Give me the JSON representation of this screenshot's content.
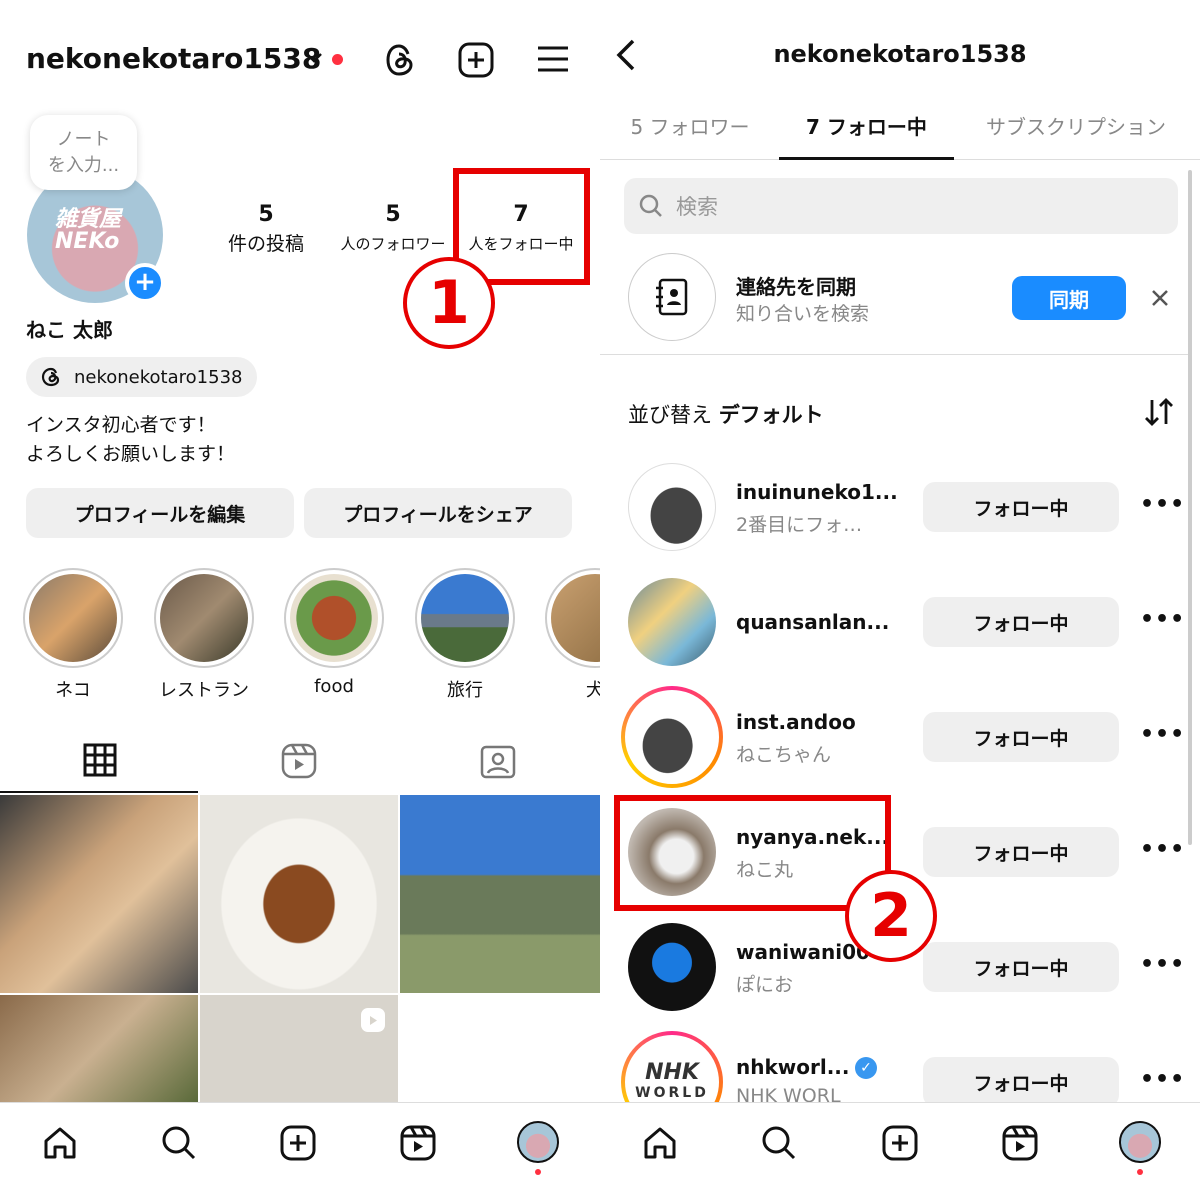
{
  "left": {
    "username": "nekonekotaro1538",
    "note": [
      "ノート",
      "を入力..."
    ],
    "avatar_text": [
      "雑貨屋",
      "NEKo"
    ],
    "stats": [
      {
        "value": "5",
        "label": "件の投稿"
      },
      {
        "value": "5",
        "label": "人のフォロワー"
      },
      {
        "value": "7",
        "label": "人をフォロー中"
      }
    ],
    "display_name": "ねこ 太郎",
    "threads_handle": "nekonekotaro1538",
    "bio": [
      "インスタ初心者です！",
      "よろしくお願いします！"
    ],
    "edit_profile": "プロフィールを編集",
    "share_profile": "プロフィールをシェア",
    "highlights": [
      "ネコ",
      "レストラン",
      "food",
      "旅行",
      "犬"
    ],
    "annotation": "1"
  },
  "right": {
    "title": "nekonekotaro1538",
    "tabs": [
      "5 フォロワー",
      "7 フォロー中",
      "サブスクリプション"
    ],
    "active_tab": 1,
    "search_placeholder": "検索",
    "sync": {
      "title": "連絡先を同期",
      "subtitle": "知り合いを検索",
      "button": "同期"
    },
    "sort": {
      "label": "並び替え",
      "value": "デフォルト"
    },
    "following": [
      {
        "name": "inuinuneko1...",
        "sub": "2番目にフォ…",
        "button": "フォロー中"
      },
      {
        "name": "quansanlan...",
        "sub": "",
        "button": "フォロー中"
      },
      {
        "name": "inst.andoo",
        "sub": "ねこちゃん",
        "button": "フォロー中"
      },
      {
        "name": "nyanya.nek...",
        "sub": "ねこ丸",
        "button": "フォロー中"
      },
      {
        "name": "waniwani00",
        "sub": "ぽにお",
        "button": "フォロー中"
      },
      {
        "name": "nhkworl...",
        "sub": "NHK WORL",
        "button": "フォロー中",
        "verified": true
      }
    ],
    "nhk_logo": [
      "NHK",
      "WORLD"
    ],
    "annotation": "2"
  },
  "colors": {
    "accent_blue": "#1a8cff",
    "annotation_red": "#e60000",
    "notification_red": "#ff3040"
  }
}
